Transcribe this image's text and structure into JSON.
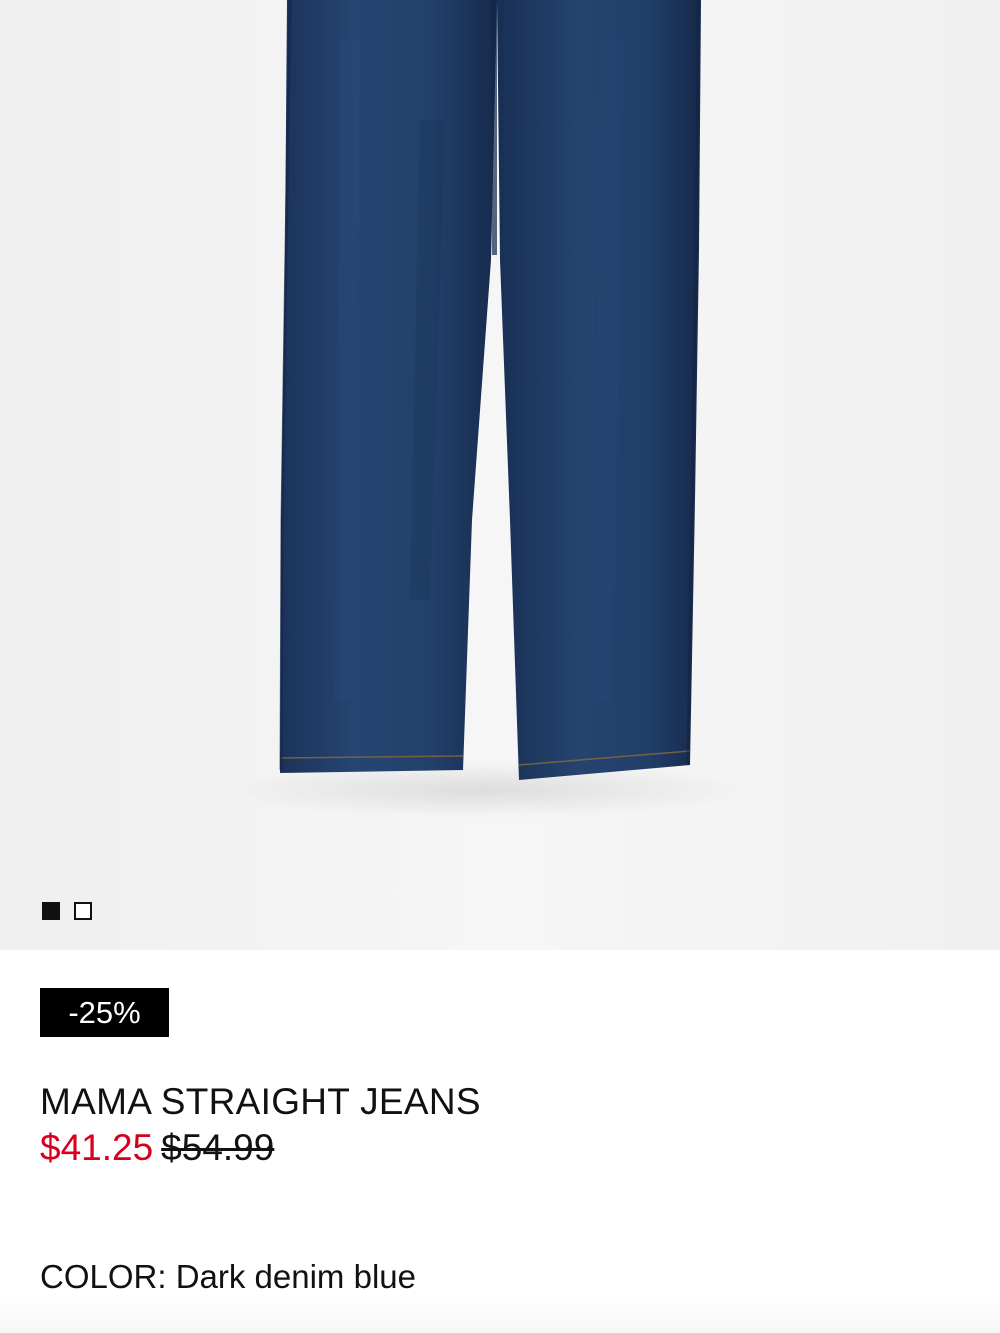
{
  "product": {
    "badge": "-25%",
    "title": "MAMA STRAIGHT JEANS",
    "price_sale": "$41.25",
    "price_original": "$54.99",
    "color_label": "COLOR:",
    "color_value": "Dark denim blue"
  },
  "gallery": {
    "image_count": 2,
    "active_index": 0
  },
  "colors": {
    "sale_red": "#d6001c",
    "denim": "#213f6b",
    "image_bg": "#f2f2f2"
  }
}
